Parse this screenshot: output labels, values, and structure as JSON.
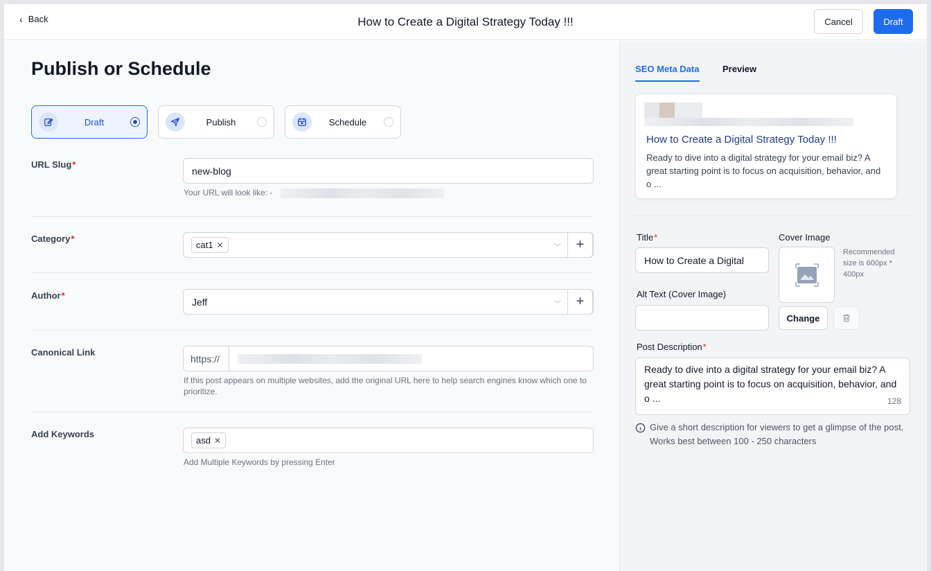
{
  "header": {
    "back_label": "Back",
    "title": "How to Create a Digital Strategy Today !!!",
    "cancel_label": "Cancel",
    "draft_label": "Draft"
  },
  "main": {
    "heading": "Publish or Schedule",
    "status_options": [
      {
        "label": "Draft",
        "icon": "edit-icon",
        "selected": true
      },
      {
        "label": "Publish",
        "icon": "send-icon",
        "selected": false
      },
      {
        "label": "Schedule",
        "icon": "calendar-icon",
        "selected": false
      }
    ],
    "url_slug": {
      "label": "URL Slug",
      "required_mark": "*",
      "value": "new-blog",
      "helper": "Your URL will look like: -"
    },
    "category": {
      "label": "Category",
      "required_mark": "*",
      "tags": [
        "cat1"
      ],
      "add_label": "+"
    },
    "author": {
      "label": "Author",
      "required_mark": "*",
      "value": "Jeff",
      "add_label": "+"
    },
    "canonical": {
      "label": "Canonical Link",
      "prefix": "https://",
      "helper": "If this post appears on multiple websites, add the original URL here to help search engines know which one to prioritize."
    },
    "keywords": {
      "label": "Add Keywords",
      "tags": [
        "asd"
      ],
      "helper": "Add Multiple Keywords by pressing Enter"
    }
  },
  "sidebar": {
    "tabs": [
      "SEO Meta Data",
      "Preview"
    ],
    "active_tab": "SEO Meta Data",
    "preview": {
      "title": "How to Create a Digital Strategy Today !!!",
      "description": "Ready to dive into a digital strategy for your email biz? A great starting point is to focus on acquisition, behavior, and o ..."
    },
    "title_field": {
      "label": "Title",
      "required_mark": "*",
      "value": "How to Create a Digital"
    },
    "cover": {
      "label": "Cover Image",
      "note": "Recommended size is 600px * 400px",
      "change_label": "Change"
    },
    "alt_text": {
      "label": "Alt Text (Cover Image)",
      "value": ""
    },
    "post_description": {
      "label": "Post Description",
      "required_mark": "*",
      "value": "Ready to dive into a digital strategy for your email biz? A great starting point is to focus on acquisition, behavior, and o ...",
      "count": "128",
      "hint": "Give a short description for viewers to get a glimpse of the post. Works best between 100 - 250 characters"
    }
  },
  "colors": {
    "primary": "#1d6cf0",
    "required": "#dc2626",
    "link_title": "#1e3a8a"
  }
}
